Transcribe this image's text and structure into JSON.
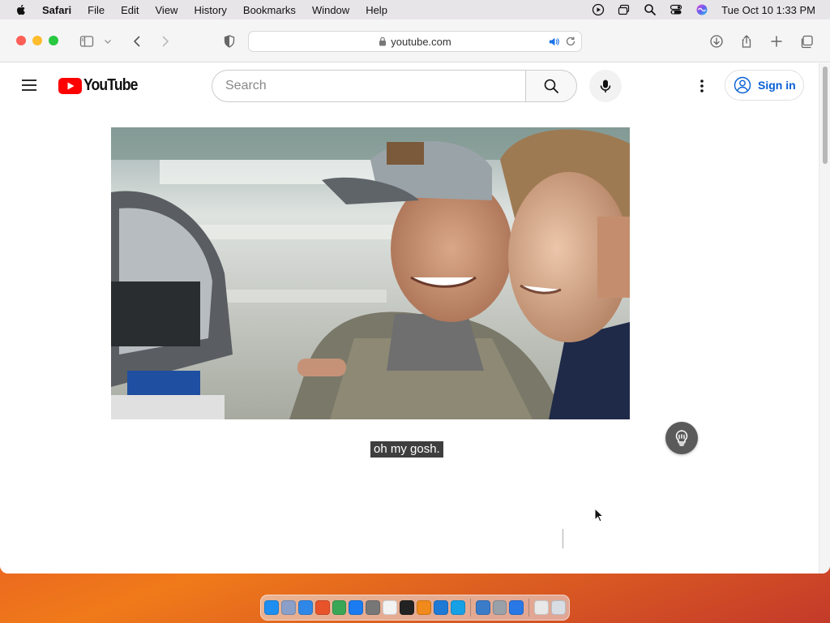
{
  "menubar": {
    "app_name": "Safari",
    "items": [
      "File",
      "Edit",
      "View",
      "History",
      "Bookmarks",
      "Window",
      "Help"
    ],
    "clock": "Tue Oct 10  1:33 PM"
  },
  "browser": {
    "url": "youtube.com"
  },
  "youtube": {
    "logo_text": "YouTube",
    "search_placeholder": "Search",
    "sign_in_label": "Sign in",
    "brand_red": "#ff0000",
    "link_blue": "#065fd4"
  },
  "video": {
    "caption": "oh my gosh."
  },
  "dock": {
    "apps": [
      {
        "name": "finder",
        "color": "#1e8ff0"
      },
      {
        "name": "launchpad",
        "color": "#8aa0c8"
      },
      {
        "name": "safari",
        "color": "#2f88e8"
      },
      {
        "name": "firefox",
        "color": "#e8532a"
      },
      {
        "name": "chrome",
        "color": "#3aa757"
      },
      {
        "name": "app-store",
        "color": "#1a7cf0"
      },
      {
        "name": "system-settings",
        "color": "#777777"
      },
      {
        "name": "textedit",
        "color": "#f2f2f2"
      },
      {
        "name": "terminal",
        "color": "#222222"
      },
      {
        "name": "vlc",
        "color": "#f08a1c"
      },
      {
        "name": "vscode",
        "color": "#1f7ad6"
      },
      {
        "name": "skype",
        "color": "#16a0e6"
      },
      {
        "name": "preview",
        "color": "#3a7cc8"
      },
      {
        "name": "screenshot",
        "color": "#9aa0a8"
      },
      {
        "name": "xcode",
        "color": "#2a78e6"
      },
      {
        "name": "finder-window",
        "color": "#e8e8e8"
      },
      {
        "name": "trash",
        "color": "#d8dde3"
      }
    ]
  }
}
